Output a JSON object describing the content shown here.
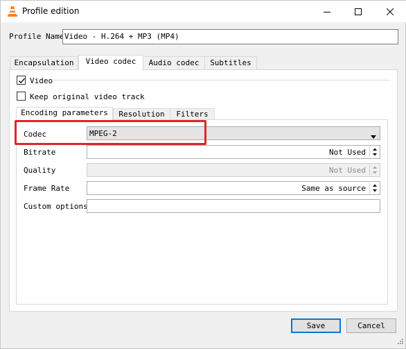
{
  "window": {
    "title": "Profile edition",
    "icon": "vlc-cone-icon"
  },
  "profile": {
    "label": "Profile Name",
    "value": "Video - H.264 + MP3 (MP4)"
  },
  "tabs": [
    {
      "label": "Encapsulation",
      "active": false
    },
    {
      "label": "Video codec",
      "active": true
    },
    {
      "label": "Audio codec",
      "active": false
    },
    {
      "label": "Subtitles",
      "active": false
    }
  ],
  "video": {
    "video_label": "Video",
    "video_checked": true,
    "keep_original_label": "Keep original video track",
    "keep_original_checked": false
  },
  "subtabs": [
    {
      "label": "Encoding parameters",
      "active": true
    },
    {
      "label": "Resolution",
      "active": false
    },
    {
      "label": "Filters",
      "active": false
    }
  ],
  "encoding": {
    "codec_label": "Codec",
    "codec_value": "MPEG-2",
    "bitrate_label": "Bitrate",
    "bitrate_value": "Not Used",
    "quality_label": "Quality",
    "quality_value": "Not Used",
    "framerate_label": "Frame Rate",
    "framerate_value": "Same as source",
    "custom_label": "Custom options",
    "custom_value": ""
  },
  "buttons": {
    "save": "Save",
    "cancel": "Cancel"
  },
  "colors": {
    "highlight": "#e0242b",
    "default_button_border": "#0078d7"
  }
}
